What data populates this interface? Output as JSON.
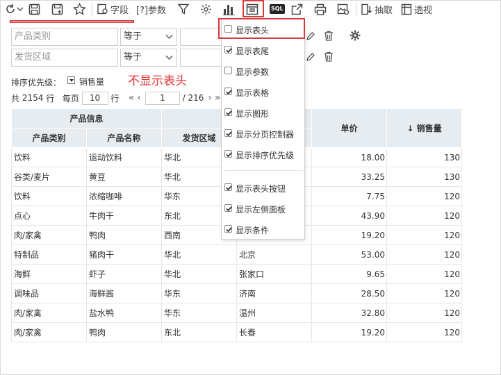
{
  "toolbar": {
    "fields_label": "字段",
    "params_label": "[?]参数",
    "sql_label": "SQL",
    "extract_label": "抽取",
    "pivot_label": "透视"
  },
  "filters": [
    {
      "field_placeholder": "产品类别",
      "operator": "等于"
    },
    {
      "field_placeholder": "发货区域",
      "operator": "等于"
    }
  ],
  "sort": {
    "label": "排序优先级：",
    "field": "销售量"
  },
  "annotation": "不显示表头",
  "pager": {
    "total_prefix": "共",
    "total_rows": "2154",
    "total_suffix": "行",
    "per_page_label": "每页",
    "per_page": "10",
    "rows_unit": "行",
    "current_page": "1",
    "page_count": "/ 216"
  },
  "table": {
    "group_header": "产品信息",
    "headers": [
      "产品类别",
      "产品名称",
      "发货区域",
      "单价",
      "销售量"
    ],
    "sort_indicator": "↓",
    "rows": [
      [
        "饮料",
        "运动饮料",
        "华北",
        "",
        "18.00",
        "130"
      ],
      [
        "谷类/麦片",
        "黄豆",
        "华北",
        "",
        "33.25",
        "130"
      ],
      [
        "饮料",
        "浓缩咖啡",
        "华东",
        "",
        "7.75",
        "120"
      ],
      [
        "点心",
        "牛肉干",
        "东北",
        "",
        "43.90",
        "120"
      ],
      [
        "肉/家禽",
        "鸭肉",
        "西南",
        "",
        "19.20",
        "120"
      ],
      [
        "特制品",
        "猪肉干",
        "华北",
        "北京",
        "53.00",
        "120"
      ],
      [
        "海鲜",
        "虾子",
        "华北",
        "张家口",
        "9.65",
        "120"
      ],
      [
        "调味品",
        "海鲜酱",
        "华东",
        "济南",
        "28.50",
        "120"
      ],
      [
        "肉/家禽",
        "盐水鸭",
        "华东",
        "温州",
        "32.80",
        "120"
      ],
      [
        "肉/家禽",
        "鸭肉",
        "东北",
        "长春",
        "19.20",
        "120"
      ]
    ]
  },
  "menu": {
    "items": [
      {
        "label": "显示表头",
        "checked": false
      },
      {
        "label": "显示表尾",
        "checked": true
      },
      {
        "label": "显示参数",
        "checked": false
      },
      {
        "label": "显示表格",
        "checked": true
      },
      {
        "label": "显示图形",
        "checked": true
      },
      {
        "label": "显示分页控制器",
        "checked": true
      },
      {
        "label": "显示排序优先级",
        "checked": true
      },
      {
        "label": "显示表头按钮",
        "checked": true
      },
      {
        "label": "显示左侧面板",
        "checked": true
      },
      {
        "label": "显示条件",
        "checked": true
      }
    ]
  },
  "colors": {
    "accent_red": "#d63a3a",
    "header_bg": "#e7ecf0",
    "annotation_red": "#e03535"
  }
}
